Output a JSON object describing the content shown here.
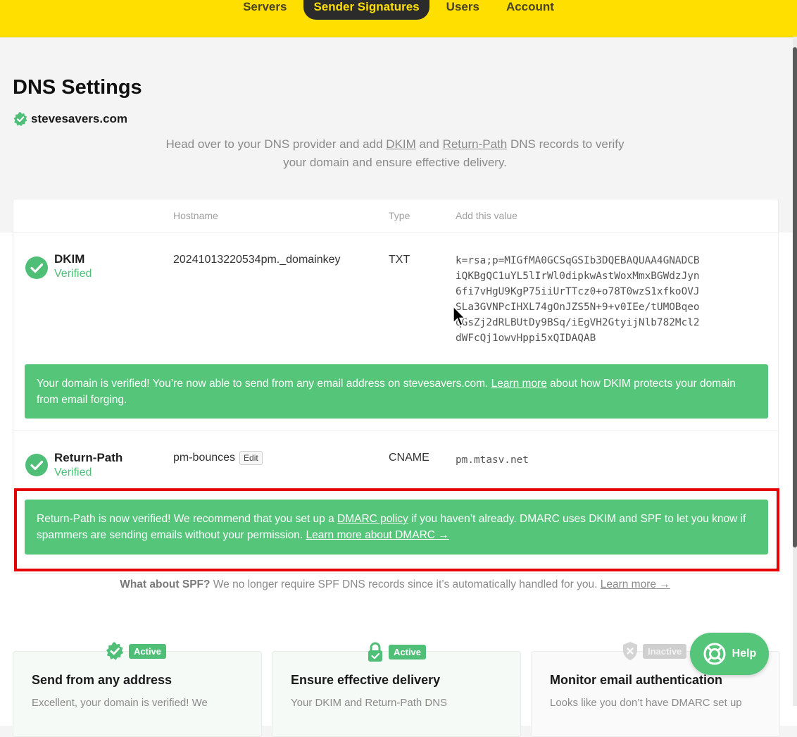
{
  "nav": {
    "tabs": [
      {
        "label": "Servers",
        "active": false
      },
      {
        "label": "Sender Signatures",
        "active": true
      },
      {
        "label": "Users",
        "active": false
      },
      {
        "label": "Account",
        "active": false
      }
    ]
  },
  "page": {
    "title": "DNS Settings",
    "domain": "stevesavers.com"
  },
  "intro": {
    "prefix": "Head over to your DNS provider and add ",
    "link_dkim": "DKIM",
    "mid": " and ",
    "link_returnpath": "Return-Path",
    "suffix": " DNS records to verify your domain and ensure effective delivery."
  },
  "table": {
    "headers": {
      "hostname": "Hostname",
      "type": "Type",
      "value": "Add this value"
    }
  },
  "records": {
    "dkim": {
      "name": "DKIM",
      "status": "Verified",
      "hostname": "20241013220534pm._domainkey",
      "type": "TXT",
      "value": "k=rsa;p=MIGfMA0GCSqGSIb3DQEBAQUAA4GNADCBiQKBgQC1uYL5lIrWl0dipkwAstWoxMmxBGWdzJyn6fi7vHgU9KgP75iiUrTTcz0+o78T0wzS1xfkoOVJSLa3GVNPcIHXL74gOnJZS5N+9+v0IEe/tUMOBqeoqGsZj2dRLBUtDy9BSq/iEgVH2GtyijNlb782Mcl2dWFcQj1owvHppi5xQIDAQAB"
    },
    "return_path": {
      "name": "Return-Path",
      "status": "Verified",
      "hostname": "pm-bounces",
      "edit_label": "Edit",
      "type": "CNAME",
      "value": "pm.mtasv.net"
    }
  },
  "alerts": {
    "dkim": {
      "prefix": "Your domain is verified! You’re now able to send from any email address on stevesavers.com. ",
      "link": "Learn more",
      "suffix": " about how DKIM protects your domain from email forging."
    },
    "return_path": {
      "prefix": "Return-Path is now verified! We recommend that you set up a ",
      "link_policy": "DMARC policy",
      "mid": " if you haven’t already. DMARC uses DKIM and SPF to let you know if spammers are sending emails without your permission. ",
      "link_learn": "Learn more about DMARC →"
    }
  },
  "spf_note": {
    "bold": "What about SPF?",
    "text": " We no longer require SPF DNS records since it’s automatically handled for you. ",
    "link": "Learn more →"
  },
  "features": [
    {
      "status": "Active",
      "title": "Send from any address",
      "desc": "Excellent, your domain is verified! We",
      "icon": "badge-check-icon",
      "active": true
    },
    {
      "status": "Active",
      "title": "Ensure effective delivery",
      "desc": "Your DKIM and Return-Path DNS",
      "icon": "lock-icon",
      "active": true
    },
    {
      "status": "Inactive",
      "title": "Monitor email authentication",
      "desc": "Looks like you don’t have DMARC set up",
      "icon": "shield-icon",
      "active": false
    }
  ],
  "help": {
    "label": "Help"
  },
  "colors": {
    "nav_bg": "#ffdf00",
    "alert_green": "#55c57a",
    "verified_green": "#4fbf77",
    "highlight_red": "#e60000"
  }
}
